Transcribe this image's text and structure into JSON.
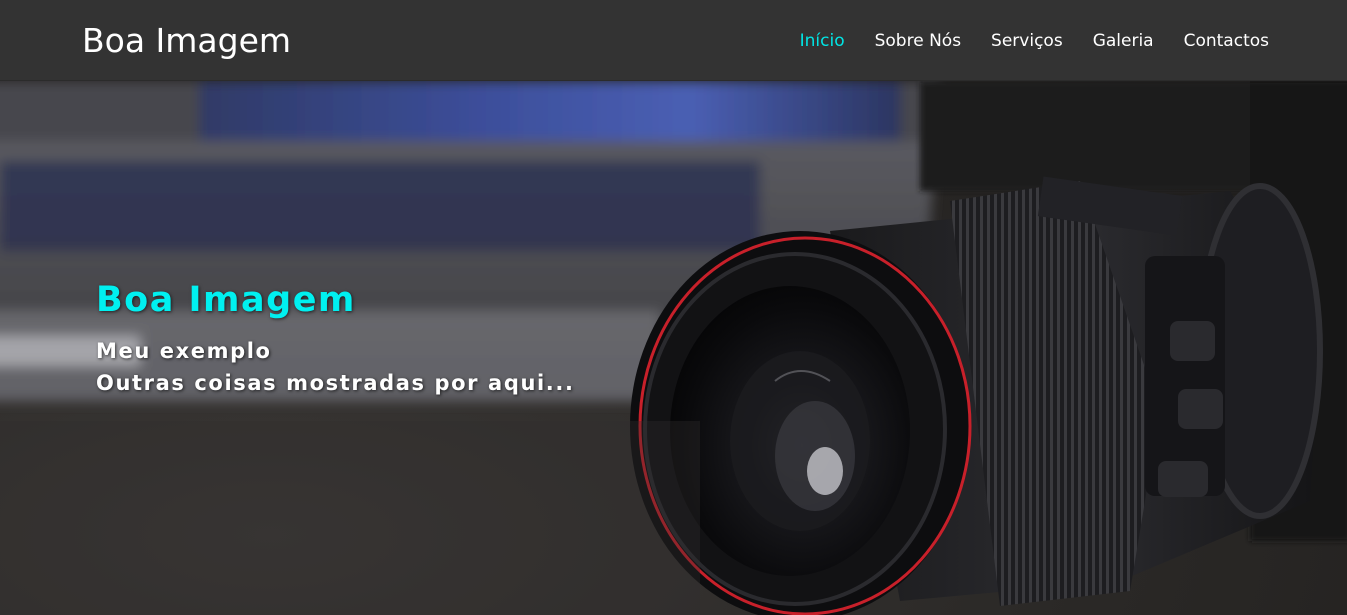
{
  "navbar": {
    "brand": "Boa Imagem",
    "items": [
      {
        "label": "Início",
        "active": true
      },
      {
        "label": "Sobre Nós",
        "active": false
      },
      {
        "label": "Serviços",
        "active": false
      },
      {
        "label": "Galeria",
        "active": false
      },
      {
        "label": "Contactos",
        "active": false
      }
    ]
  },
  "hero": {
    "title": "Boa Imagem",
    "line1": "Meu exemplo",
    "line2": "Outras coisas mostradas por aqui...",
    "background_image": "camera-lens-photo"
  },
  "colors": {
    "navbar_bg": "#333333",
    "accent": "#00e5e5",
    "text": "#ffffff"
  }
}
